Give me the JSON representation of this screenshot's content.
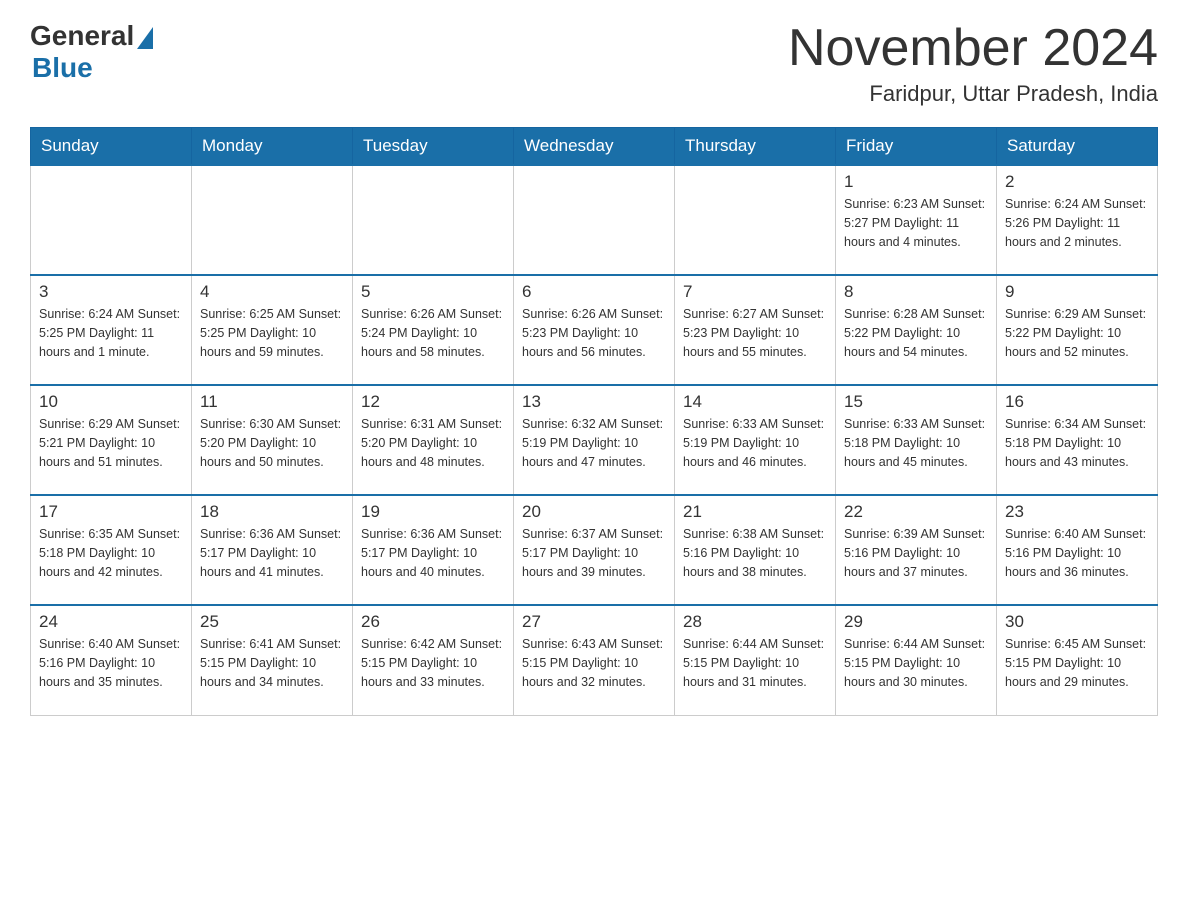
{
  "header": {
    "logo_general": "General",
    "logo_blue": "Blue",
    "title": "November 2024",
    "subtitle": "Faridpur, Uttar Pradesh, India"
  },
  "weekdays": [
    "Sunday",
    "Monday",
    "Tuesday",
    "Wednesday",
    "Thursday",
    "Friday",
    "Saturday"
  ],
  "weeks": [
    [
      {
        "day": "",
        "info": ""
      },
      {
        "day": "",
        "info": ""
      },
      {
        "day": "",
        "info": ""
      },
      {
        "day": "",
        "info": ""
      },
      {
        "day": "",
        "info": ""
      },
      {
        "day": "1",
        "info": "Sunrise: 6:23 AM\nSunset: 5:27 PM\nDaylight: 11 hours and 4 minutes."
      },
      {
        "day": "2",
        "info": "Sunrise: 6:24 AM\nSunset: 5:26 PM\nDaylight: 11 hours and 2 minutes."
      }
    ],
    [
      {
        "day": "3",
        "info": "Sunrise: 6:24 AM\nSunset: 5:25 PM\nDaylight: 11 hours and 1 minute."
      },
      {
        "day": "4",
        "info": "Sunrise: 6:25 AM\nSunset: 5:25 PM\nDaylight: 10 hours and 59 minutes."
      },
      {
        "day": "5",
        "info": "Sunrise: 6:26 AM\nSunset: 5:24 PM\nDaylight: 10 hours and 58 minutes."
      },
      {
        "day": "6",
        "info": "Sunrise: 6:26 AM\nSunset: 5:23 PM\nDaylight: 10 hours and 56 minutes."
      },
      {
        "day": "7",
        "info": "Sunrise: 6:27 AM\nSunset: 5:23 PM\nDaylight: 10 hours and 55 minutes."
      },
      {
        "day": "8",
        "info": "Sunrise: 6:28 AM\nSunset: 5:22 PM\nDaylight: 10 hours and 54 minutes."
      },
      {
        "day": "9",
        "info": "Sunrise: 6:29 AM\nSunset: 5:22 PM\nDaylight: 10 hours and 52 minutes."
      }
    ],
    [
      {
        "day": "10",
        "info": "Sunrise: 6:29 AM\nSunset: 5:21 PM\nDaylight: 10 hours and 51 minutes."
      },
      {
        "day": "11",
        "info": "Sunrise: 6:30 AM\nSunset: 5:20 PM\nDaylight: 10 hours and 50 minutes."
      },
      {
        "day": "12",
        "info": "Sunrise: 6:31 AM\nSunset: 5:20 PM\nDaylight: 10 hours and 48 minutes."
      },
      {
        "day": "13",
        "info": "Sunrise: 6:32 AM\nSunset: 5:19 PM\nDaylight: 10 hours and 47 minutes."
      },
      {
        "day": "14",
        "info": "Sunrise: 6:33 AM\nSunset: 5:19 PM\nDaylight: 10 hours and 46 minutes."
      },
      {
        "day": "15",
        "info": "Sunrise: 6:33 AM\nSunset: 5:18 PM\nDaylight: 10 hours and 45 minutes."
      },
      {
        "day": "16",
        "info": "Sunrise: 6:34 AM\nSunset: 5:18 PM\nDaylight: 10 hours and 43 minutes."
      }
    ],
    [
      {
        "day": "17",
        "info": "Sunrise: 6:35 AM\nSunset: 5:18 PM\nDaylight: 10 hours and 42 minutes."
      },
      {
        "day": "18",
        "info": "Sunrise: 6:36 AM\nSunset: 5:17 PM\nDaylight: 10 hours and 41 minutes."
      },
      {
        "day": "19",
        "info": "Sunrise: 6:36 AM\nSunset: 5:17 PM\nDaylight: 10 hours and 40 minutes."
      },
      {
        "day": "20",
        "info": "Sunrise: 6:37 AM\nSunset: 5:17 PM\nDaylight: 10 hours and 39 minutes."
      },
      {
        "day": "21",
        "info": "Sunrise: 6:38 AM\nSunset: 5:16 PM\nDaylight: 10 hours and 38 minutes."
      },
      {
        "day": "22",
        "info": "Sunrise: 6:39 AM\nSunset: 5:16 PM\nDaylight: 10 hours and 37 minutes."
      },
      {
        "day": "23",
        "info": "Sunrise: 6:40 AM\nSunset: 5:16 PM\nDaylight: 10 hours and 36 minutes."
      }
    ],
    [
      {
        "day": "24",
        "info": "Sunrise: 6:40 AM\nSunset: 5:16 PM\nDaylight: 10 hours and 35 minutes."
      },
      {
        "day": "25",
        "info": "Sunrise: 6:41 AM\nSunset: 5:15 PM\nDaylight: 10 hours and 34 minutes."
      },
      {
        "day": "26",
        "info": "Sunrise: 6:42 AM\nSunset: 5:15 PM\nDaylight: 10 hours and 33 minutes."
      },
      {
        "day": "27",
        "info": "Sunrise: 6:43 AM\nSunset: 5:15 PM\nDaylight: 10 hours and 32 minutes."
      },
      {
        "day": "28",
        "info": "Sunrise: 6:44 AM\nSunset: 5:15 PM\nDaylight: 10 hours and 31 minutes."
      },
      {
        "day": "29",
        "info": "Sunrise: 6:44 AM\nSunset: 5:15 PM\nDaylight: 10 hours and 30 minutes."
      },
      {
        "day": "30",
        "info": "Sunrise: 6:45 AM\nSunset: 5:15 PM\nDaylight: 10 hours and 29 minutes."
      }
    ]
  ]
}
